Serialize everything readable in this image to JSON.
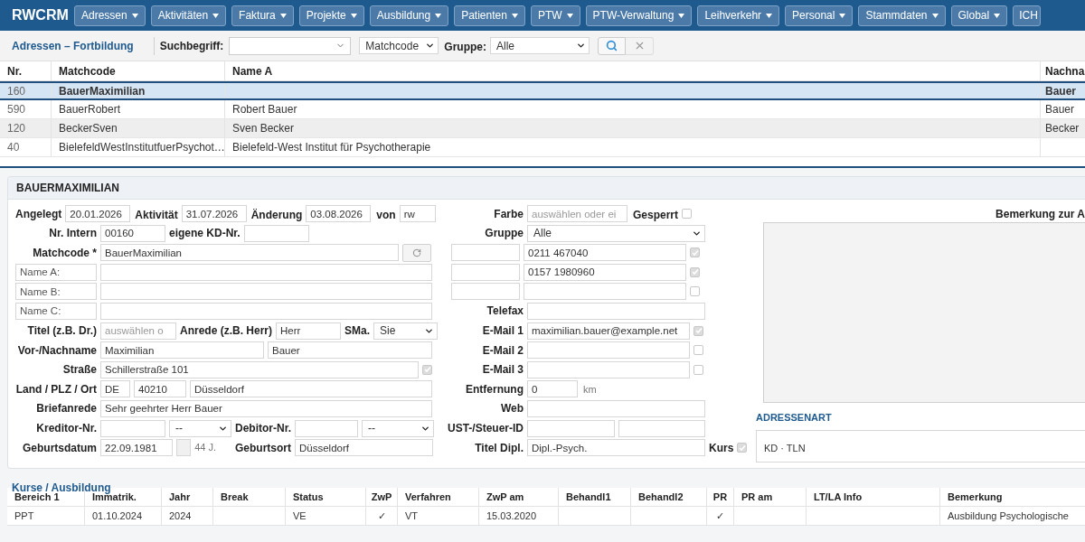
{
  "nav": {
    "brand": "RWCRM",
    "menus": [
      {
        "label": "Adressen",
        "caret": true
      },
      {
        "label": "Aktivitäten",
        "caret": true
      },
      {
        "label": "Faktura",
        "caret": true
      },
      {
        "label": "Projekte",
        "caret": true
      },
      {
        "label": "Ausbildung",
        "caret": true
      },
      {
        "label": "Patienten",
        "caret": true
      },
      {
        "label": "PTW",
        "caret": true
      },
      {
        "label": "PTW-Verwaltung",
        "caret": true
      },
      {
        "label": "Leihverkehr",
        "caret": true
      },
      {
        "label": "Personal",
        "caret": true
      },
      {
        "label": "Stammdaten",
        "caret": true
      },
      {
        "label": "Global",
        "caret": true
      },
      {
        "label": "ICH",
        "caret": false
      }
    ]
  },
  "toolbar": {
    "title": "Adressen – Fortbildung",
    "search_label": "Suchbegriff:",
    "field_select": "Matchcode",
    "group_label": "Gruppe:",
    "group_value": "Alle"
  },
  "list": {
    "columns": [
      "Nr.",
      "Matchcode",
      "Name A",
      "Nachna"
    ],
    "rows": [
      {
        "selected": true,
        "cells": [
          "160",
          "BauerMaximilian",
          null,
          "Bauer"
        ]
      },
      {
        "selected": false,
        "cells": [
          "590",
          "BauerRobert",
          "Robert Bauer",
          "Bauer"
        ]
      },
      {
        "selected": false,
        "cells": [
          "120",
          "BeckerSven",
          "Sven Becker",
          "Becker"
        ]
      },
      {
        "selected": false,
        "cells": [
          "40",
          "BielefeldWestInstitutfuerPsychot…",
          "Bielefeld-West Institut für Psychotherapie",
          null
        ]
      }
    ]
  },
  "record": {
    "title": "BAUERMAXIMILIAN",
    "angelegt": {
      "label": "Angelegt",
      "value": "20.01.2026"
    },
    "aktivitaet": {
      "label": "Aktivität",
      "value": "31.07.2026"
    },
    "aenderung": {
      "label": "Änderung",
      "value": "03.08.2026"
    },
    "von": {
      "label": "von",
      "value": "rw"
    },
    "nr_intern": {
      "label": "Nr. Intern",
      "value": "00160"
    },
    "eigene_kd_nr": {
      "label": "eigene KD-Nr."
    },
    "matchcode": {
      "label": "Matchcode *",
      "value": "BauerMaximilian"
    },
    "names": [
      {
        "label": "Name A:"
      },
      {
        "label": "Name B:"
      },
      {
        "label": "Name C:"
      }
    ],
    "titel": {
      "label": "Titel (z.B. Dr.)",
      "placeholder": "auswählen o"
    },
    "anrede": {
      "label": "Anrede (z.B. Herr)",
      "value": "Herr"
    },
    "sma": {
      "label": "SMa.",
      "value": "Sie"
    },
    "vorname": {
      "label": "Vor-/Nachname",
      "first": "Maximilian",
      "last": "Bauer"
    },
    "strasse": {
      "label": "Straße",
      "value": "Schillerstraße 101",
      "checked": true
    },
    "ort": {
      "label": "Land / PLZ / Ort",
      "land": "DE",
      "plz": "40210",
      "ort": "Düsseldorf"
    },
    "briefanrede": {
      "label": "Briefanrede",
      "value": "Sehr geehrter Herr Bauer"
    },
    "kreditor": {
      "label": "Kreditor-Nr.",
      "select": "--"
    },
    "debitor": {
      "label": "Debitor-Nr.",
      "select": "--"
    },
    "geburtsdatum": {
      "label": "Geburtsdatum",
      "value": "22.09.1981",
      "age": "44 J."
    },
    "geburtsort": {
      "label": "Geburtsort",
      "value": "Düsseldorf"
    },
    "farbe": {
      "label": "Farbe",
      "placeholder": "auswählen oder ei"
    },
    "gesperrt": {
      "label": "Gesperrt",
      "checked": false
    },
    "gruppe": {
      "label": "Gruppe",
      "value": "Alle"
    },
    "phones": [
      {
        "value": "0211 467040",
        "checked": true
      },
      {
        "value": "0157 1980960",
        "checked": true
      },
      {
        "checked": false
      }
    ],
    "telefax": {
      "label": "Telefax"
    },
    "emails": [
      {
        "label": "E-Mail 1",
        "value": "maximilian.bauer@example.net",
        "checked": true
      },
      {
        "label": "E-Mail 2",
        "checked": false
      },
      {
        "label": "E-Mail 3",
        "checked": false
      }
    ],
    "entfernung": {
      "label": "Entfernung",
      "value": "0",
      "unit": "km"
    },
    "web": {
      "label": "Web"
    },
    "ust": {
      "label": "UST-/Steuer-ID"
    },
    "titel_dipl": {
      "label": "Titel Dipl.",
      "value": "Dipl.-Psych."
    },
    "kurs": {
      "label": "Kurs",
      "checked": true
    },
    "bemerkung_label": "Bemerkung zur A",
    "adressenart": {
      "title": "ADRESSENART",
      "value": "KD · TLN"
    }
  },
  "courses": {
    "title": "Kurse / Ausbildung",
    "columns": [
      "Bereich 1",
      "Immatrik.",
      "Jahr",
      "Break",
      "Status",
      "ZwP",
      "Verfahren",
      "ZwP am",
      "Behandl1",
      "Behandl2",
      "PR",
      "PR am",
      "LT/LA Info",
      "Bemerkung"
    ],
    "rows": [
      {
        "cells": [
          "PPT",
          "01.10.2024",
          "2024",
          null,
          "VE",
          "✓",
          "VT",
          "15.03.2020",
          null,
          null,
          "✓",
          null,
          null,
          "Ausbildung Psychologische"
        ]
      }
    ]
  }
}
